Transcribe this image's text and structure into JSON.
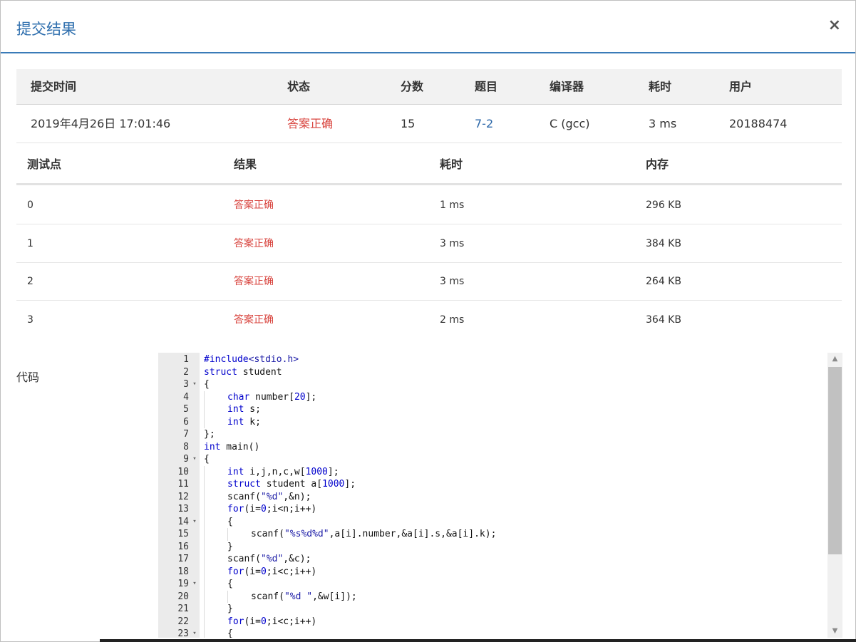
{
  "dialog": {
    "title": "提交结果",
    "close_label": "×"
  },
  "summary": {
    "headers": [
      "提交时间",
      "状态",
      "分数",
      "题目",
      "编译器",
      "耗时",
      "用户"
    ],
    "row": {
      "time": "2019年4月26日 17:01:46",
      "status": "答案正确",
      "score": "15",
      "problem": "7-2",
      "compiler": "C (gcc)",
      "elapsed": "3 ms",
      "user": "20188474"
    }
  },
  "tests": {
    "headers": [
      "测试点",
      "结果",
      "耗时",
      "内存"
    ],
    "rows": [
      {
        "id": "0",
        "result": "答案正确",
        "time": "1 ms",
        "memory": "296 KB"
      },
      {
        "id": "1",
        "result": "答案正确",
        "time": "3 ms",
        "memory": "384 KB"
      },
      {
        "id": "2",
        "result": "答案正确",
        "time": "3 ms",
        "memory": "264 KB"
      },
      {
        "id": "3",
        "result": "答案正确",
        "time": "2 ms",
        "memory": "364 KB"
      }
    ]
  },
  "code_section": {
    "label": "代码",
    "lines": [
      {
        "n": "1",
        "fold": false,
        "indent": 0,
        "text": "#include<stdio.h>"
      },
      {
        "n": "2",
        "fold": false,
        "indent": 0,
        "text": "struct student"
      },
      {
        "n": "3",
        "fold": true,
        "indent": 0,
        "text": "{"
      },
      {
        "n": "4",
        "fold": false,
        "indent": 1,
        "text": "char number[20];"
      },
      {
        "n": "5",
        "fold": false,
        "indent": 1,
        "text": "int s;"
      },
      {
        "n": "6",
        "fold": false,
        "indent": 1,
        "text": "int k;"
      },
      {
        "n": "7",
        "fold": false,
        "indent": 0,
        "text": "};"
      },
      {
        "n": "8",
        "fold": false,
        "indent": 0,
        "text": "int main()"
      },
      {
        "n": "9",
        "fold": true,
        "indent": 0,
        "text": "{"
      },
      {
        "n": "10",
        "fold": false,
        "indent": 1,
        "text": "int i,j,n,c,w[1000];"
      },
      {
        "n": "11",
        "fold": false,
        "indent": 1,
        "text": "struct student a[1000];"
      },
      {
        "n": "12",
        "fold": false,
        "indent": 1,
        "text": "scanf(\"%d\",&n);"
      },
      {
        "n": "13",
        "fold": false,
        "indent": 1,
        "text": "for(i=0;i<n;i++)"
      },
      {
        "n": "14",
        "fold": true,
        "indent": 1,
        "text": "{"
      },
      {
        "n": "15",
        "fold": false,
        "indent": 2,
        "text": "scanf(\"%s%d%d\",a[i].number,&a[i].s,&a[i].k);"
      },
      {
        "n": "16",
        "fold": false,
        "indent": 1,
        "text": "}"
      },
      {
        "n": "17",
        "fold": false,
        "indent": 1,
        "text": "scanf(\"%d\",&c);"
      },
      {
        "n": "18",
        "fold": false,
        "indent": 1,
        "text": "for(i=0;i<c;i++)"
      },
      {
        "n": "19",
        "fold": true,
        "indent": 1,
        "text": "{"
      },
      {
        "n": "20",
        "fold": false,
        "indent": 2,
        "text": "scanf(\"%d \",&w[i]);"
      },
      {
        "n": "21",
        "fold": false,
        "indent": 1,
        "text": "}"
      },
      {
        "n": "22",
        "fold": false,
        "indent": 1,
        "text": "for(i=0;i<c;i++)"
      },
      {
        "n": "23",
        "fold": true,
        "indent": 1,
        "text": "{"
      }
    ]
  },
  "icons": {
    "fold": "fold-arrow-icon",
    "scroll_up": "scroll-up-arrow-icon",
    "scroll_down": "scroll-down-arrow-icon"
  },
  "colors": {
    "accent": "#2f6fae",
    "success": "#d8433d",
    "link": "#2a66a8"
  }
}
